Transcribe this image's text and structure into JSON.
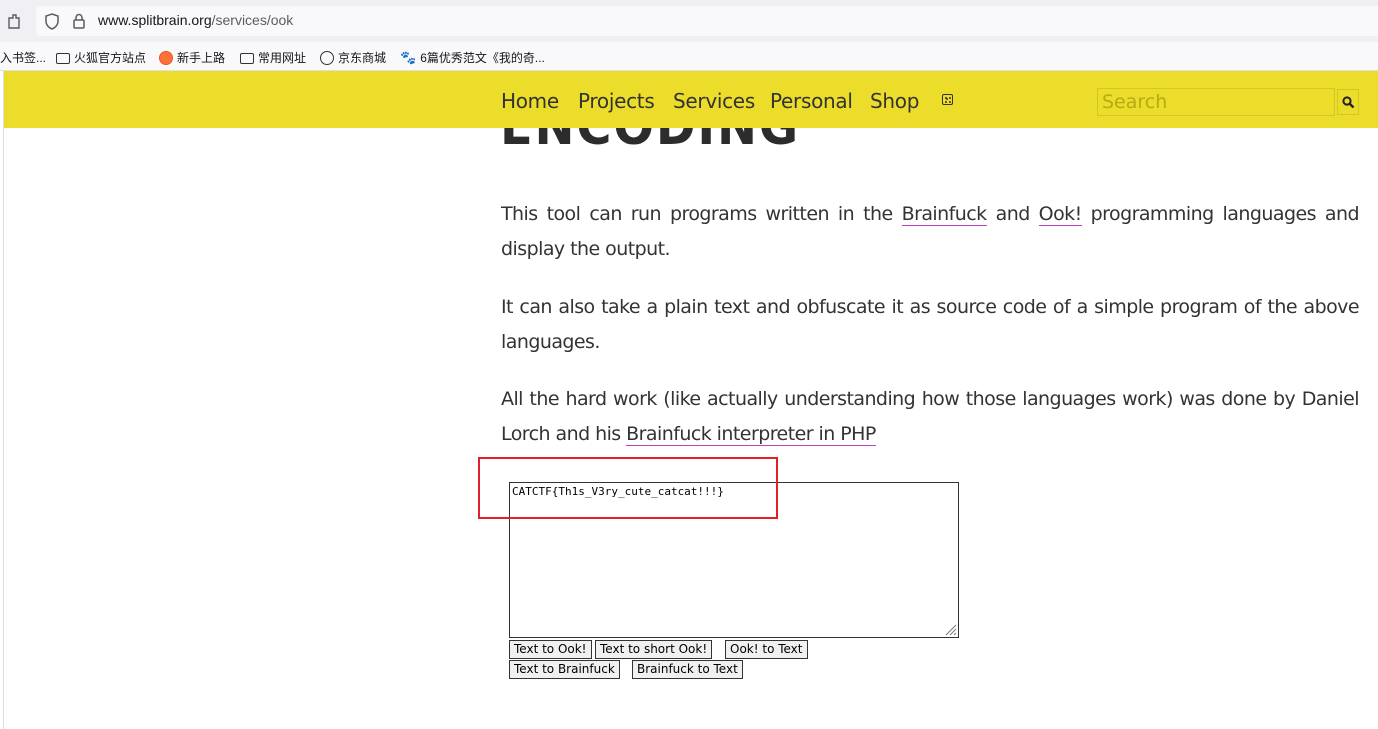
{
  "browser": {
    "url_host": "www.splitbrain.org",
    "url_path": "/services/ook",
    "bookmarks": [
      {
        "label": "入书签...",
        "icon": "none"
      },
      {
        "label": "火狐官方站点",
        "icon": "folder-icon"
      },
      {
        "label": "新手上路",
        "icon": "firefox-icon"
      },
      {
        "label": "常用网址",
        "icon": "folder-icon"
      },
      {
        "label": "京东商城",
        "icon": "globe-icon"
      },
      {
        "label": "6篇优秀范文《我的奇...",
        "icon": "baidu-paw-icon"
      }
    ]
  },
  "nav": {
    "items": [
      "Home",
      "Projects",
      "Services",
      "Personal",
      "Shop"
    ],
    "random_icon": "dice-icon",
    "search_placeholder": "Search",
    "accent_color": "#ebdd2a"
  },
  "heading": "ENCODING",
  "paragraphs": {
    "p1_before": "This tool can run programs written in the ",
    "p1_link1": "Brainfuck",
    "p1_mid": " and ",
    "p1_link2": "Ook!",
    "p1_after": " programming languages and display the output.",
    "p2": "It can also take a plain text and obfuscate it as source code of a simple program of the above languages.",
    "p3_before": "All the hard work (like actually understanding how those languages work) was done by Daniel Lorch and his ",
    "p3_link": "Brainfuck interpreter in PHP"
  },
  "editor": {
    "value": "CATCTF{Th1s_V3ry_cute_catcat!!!}"
  },
  "buttons": {
    "text_to_ook": "Text to Ook!",
    "text_to_short_ook": "Text to short Ook!",
    "ook_to_text": "Ook! to Text",
    "text_to_brainfuck": "Text to Brainfuck",
    "brainfuck_to_text": "Brainfuck to Text"
  },
  "annotation_color": "#e0202a"
}
